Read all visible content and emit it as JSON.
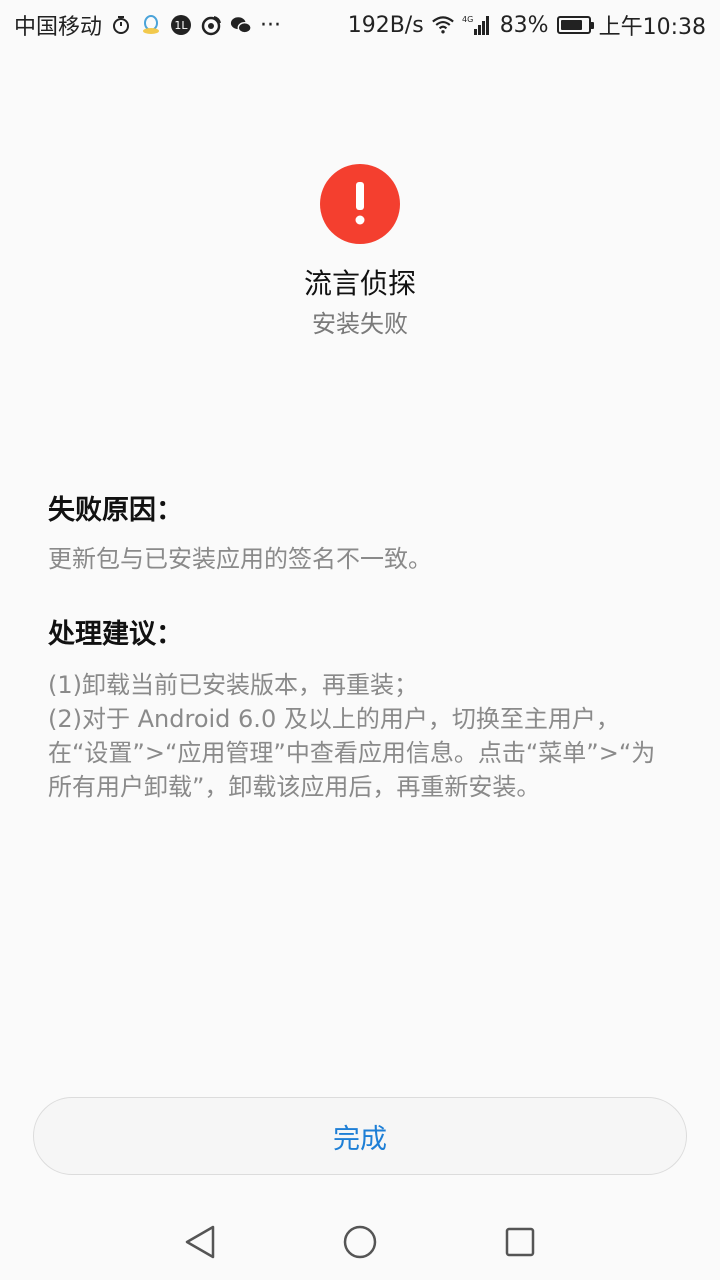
{
  "status_bar": {
    "carrier": "中国移动",
    "network_speed": "192B/s",
    "network_type": "4G",
    "battery_percent": "83%",
    "battery_level": 0.83,
    "time": "上午10:38",
    "more_dots": "···",
    "icons": [
      "alarm-icon",
      "qq-icon",
      "app-badge-icon",
      "weibo-icon",
      "wechat-icon",
      "wifi-icon",
      "signal-icon",
      "battery-icon"
    ]
  },
  "header": {
    "app_name": "流言侦探",
    "status": "安装失败",
    "icon": "error-icon",
    "accent_color": "#f43f2f"
  },
  "reason": {
    "title": "失败原因：",
    "body": "更新包与已安装应用的签名不一致。"
  },
  "advice": {
    "title": "处理建议：",
    "lines": [
      "(1)卸载当前已安装版本，再重装；",
      "(2)对于 Android 6.0 及以上的用户，切换至主用户，",
      "在“设置”>“应用管理”中查看应用信息。点击“菜单”>“为",
      "所有用户卸载”，卸载该应用后，再重新安装。"
    ]
  },
  "done_button": {
    "label": "完成",
    "color": "#1e7fd6"
  },
  "nav_bar": {
    "icons": [
      "back-icon",
      "home-icon",
      "recents-icon"
    ]
  }
}
